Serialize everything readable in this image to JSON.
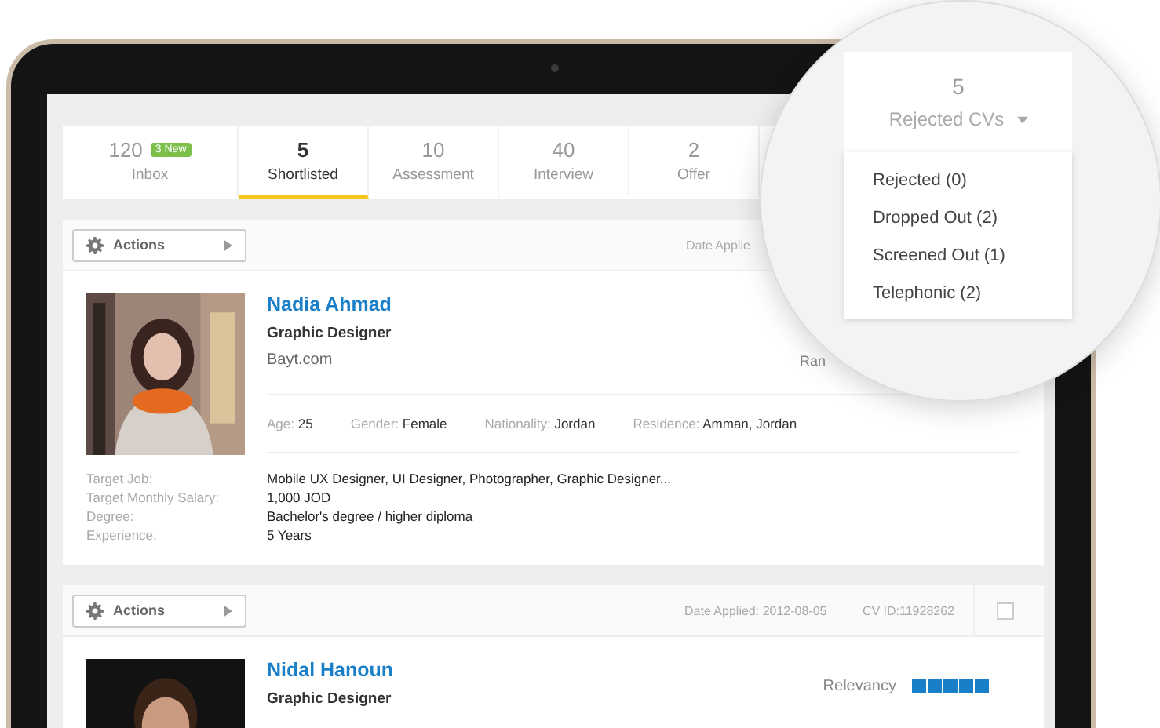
{
  "tabs": [
    {
      "count": "120",
      "label": "Inbox",
      "badge": "3 New",
      "selected": false
    },
    {
      "count": "5",
      "label": "Shortlisted",
      "selected": true
    },
    {
      "count": "10",
      "label": "Assessment",
      "selected": false
    },
    {
      "count": "40",
      "label": "Interview",
      "selected": false
    },
    {
      "count": "2",
      "label": "Offer",
      "selected": false
    }
  ],
  "magnifier": {
    "tab": {
      "count": "5",
      "label": "Rejected CVs"
    },
    "menu": [
      "Rejected (0)",
      "Dropped Out (2)",
      "Screened Out (1)",
      "Telephonic (2)"
    ]
  },
  "candidates": [
    {
      "actions": "Actions",
      "date_applied": "Date Applie",
      "name": "Nadia Ahmad",
      "title": "Graphic Designer",
      "source": "Bayt.com",
      "rank_label": "Ran",
      "facts": [
        {
          "label": "Age:",
          "value": "25"
        },
        {
          "label": "Gender:",
          "value": "Female"
        },
        {
          "label": "Nationality:",
          "value": "Jordan"
        },
        {
          "label": "Residence:",
          "value": "Amman, Jordan"
        }
      ],
      "details": [
        {
          "label": "Target Job:",
          "value": "Mobile UX Designer, UI Designer, Photographer, Graphic Designer..."
        },
        {
          "label": "Target Monthly Salary:",
          "value": "1,000 JOD"
        },
        {
          "label": "Degree:",
          "value": "Bachelor's degree / higher diploma"
        },
        {
          "label": "Experience:",
          "value": "5 Years"
        }
      ]
    },
    {
      "actions": "Actions",
      "date_applied": "Date Applied: 2012-08-05",
      "cv_id": "CV ID:11928262",
      "checked": false,
      "name": "Nidal Hanoun",
      "title": "Graphic Designer",
      "relevancy_label": "Relevancy",
      "stars": 5
    }
  ]
}
